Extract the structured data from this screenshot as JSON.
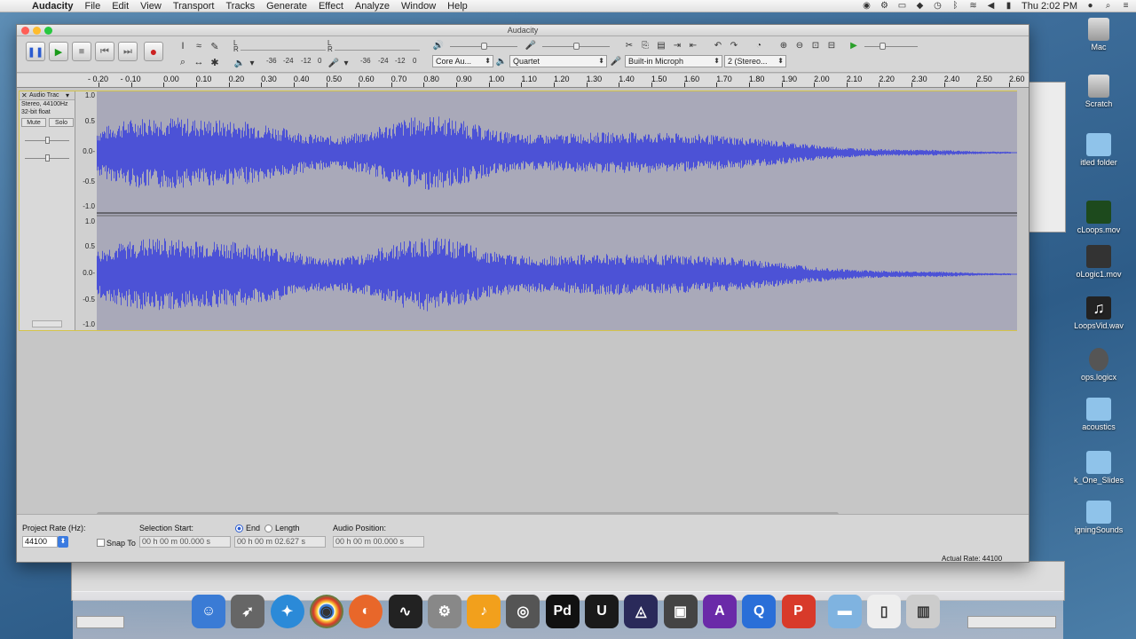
{
  "menubar": {
    "app_name": "Audacity",
    "items": [
      "File",
      "Edit",
      "View",
      "Transport",
      "Tracks",
      "Generate",
      "Effect",
      "Analyze",
      "Window",
      "Help"
    ],
    "clock": "Thu 2:02 PM"
  },
  "desktop": {
    "items": [
      "Mac",
      "Scratch",
      "itled folder",
      "cLoops.mov",
      "oLogic1.mov",
      "LoopsVid.wav",
      "ops.logicx",
      "acoustics",
      "k_One_Slides",
      "igningSounds"
    ]
  },
  "window": {
    "title": "Audacity"
  },
  "toolbar": {
    "meter_ticks_a": [
      "-36",
      "-24",
      "-12",
      "0"
    ],
    "meter_ticks_b": [
      "-36",
      "-24",
      "-12",
      "0"
    ],
    "meter_channels": [
      "L",
      "R"
    ],
    "host": "Core Au...",
    "output_device": "Quartet",
    "input_device": "Built-in Microph",
    "channels": "2 (Stereo..."
  },
  "ruler": {
    "labels": [
      "- 0.20",
      "- 0.10",
      "0.00",
      "0.10",
      "0.20",
      "0.30",
      "0.40",
      "0.50",
      "0.60",
      "0.70",
      "0.80",
      "0.90",
      "1.00",
      "1.10",
      "1.20",
      "1.30",
      "1.40",
      "1.50",
      "1.60",
      "1.70",
      "1.80",
      "1.90",
      "2.00",
      "2.10",
      "2.20",
      "2.30",
      "2.40",
      "2.50",
      "2.60"
    ]
  },
  "track": {
    "name": "Audio Trac",
    "info1": "Stereo, 44100Hz",
    "info2": "32-bit float",
    "mute": "Mute",
    "solo": "Solo",
    "scale": [
      "1.0",
      "0.5",
      "0.0-",
      "-0.5",
      "-1.0"
    ],
    "scale2": [
      "1.0",
      "0.5",
      "0.0-",
      "-0.5",
      "-1.0"
    ]
  },
  "status": {
    "project_rate_label": "Project Rate (Hz):",
    "project_rate": "44100",
    "snap_to": "Snap To",
    "selection_start_label": "Selection Start:",
    "end_label": "End",
    "length_label": "Length",
    "audio_position_label": "Audio Position:",
    "selection_start": "00 h 00 m 00.000 s",
    "selection_end": "00 h 00 m 02.627 s",
    "audio_position": "00 h 00 m 00.000 s",
    "actual_rate": "Actual Rate: 44100"
  },
  "colors": {
    "waveform": "#4c52d6",
    "track_border": "#d4c34a",
    "record_red": "#cc2222"
  },
  "dock": {
    "apps": [
      "finder-icon",
      "launchpad-icon",
      "safari-icon",
      "chrome-icon",
      "firefox-icon",
      "activity-monitor-icon",
      "system-preferences-icon",
      "audacity-icon",
      "disk-utility-icon",
      "pd-icon",
      "unreal-icon",
      "logic-icon",
      "compressor-icon",
      "affinity-icon",
      "quicktime-icon",
      "keynote-icon",
      "folder-icon",
      "zip-icon",
      "trash-icon"
    ]
  }
}
